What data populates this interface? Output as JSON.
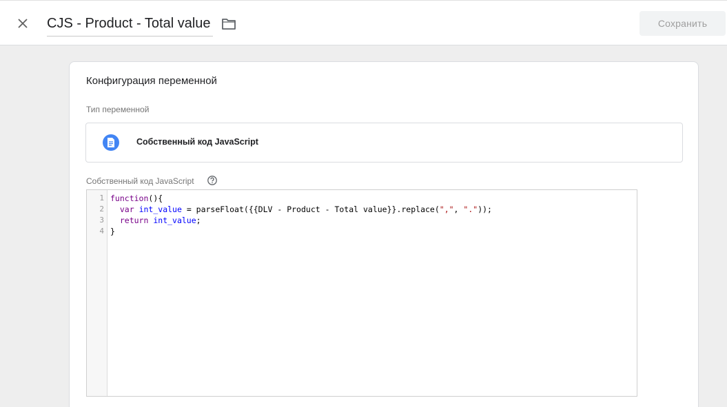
{
  "header": {
    "title": "CJS - Product - Total value",
    "save_label": "Сохранить"
  },
  "card": {
    "title": "Конфигурация переменной",
    "type_label": "Тип переменной",
    "type_name": "Собственный код JavaScript",
    "type_icon": "document-icon",
    "code_label": "Собственный код JavaScript"
  },
  "editor": {
    "line_numbers": [
      "1",
      "2",
      "3",
      "4"
    ],
    "lines": {
      "l1_kw": "function",
      "l1_rest": "(){",
      "l2_indent": "  ",
      "l2_kw": "var",
      "l2_sp": " ",
      "l2_var": "int_value",
      "l2_mid": " = parseFloat({{DLV - Product - Total value}}.replace(",
      "l2_str1": "\",\"",
      "l2_comma": ", ",
      "l2_str2": "\".\"",
      "l2_end": "));",
      "l3_indent": "  ",
      "l3_kw": "return",
      "l3_sp": " ",
      "l3_var": "int_value",
      "l3_end": ";",
      "l4": "}"
    }
  },
  "colors": {
    "keyword": "#770088",
    "variable": "#0000ff",
    "string": "#aa1111",
    "accent": "#4285f4"
  }
}
